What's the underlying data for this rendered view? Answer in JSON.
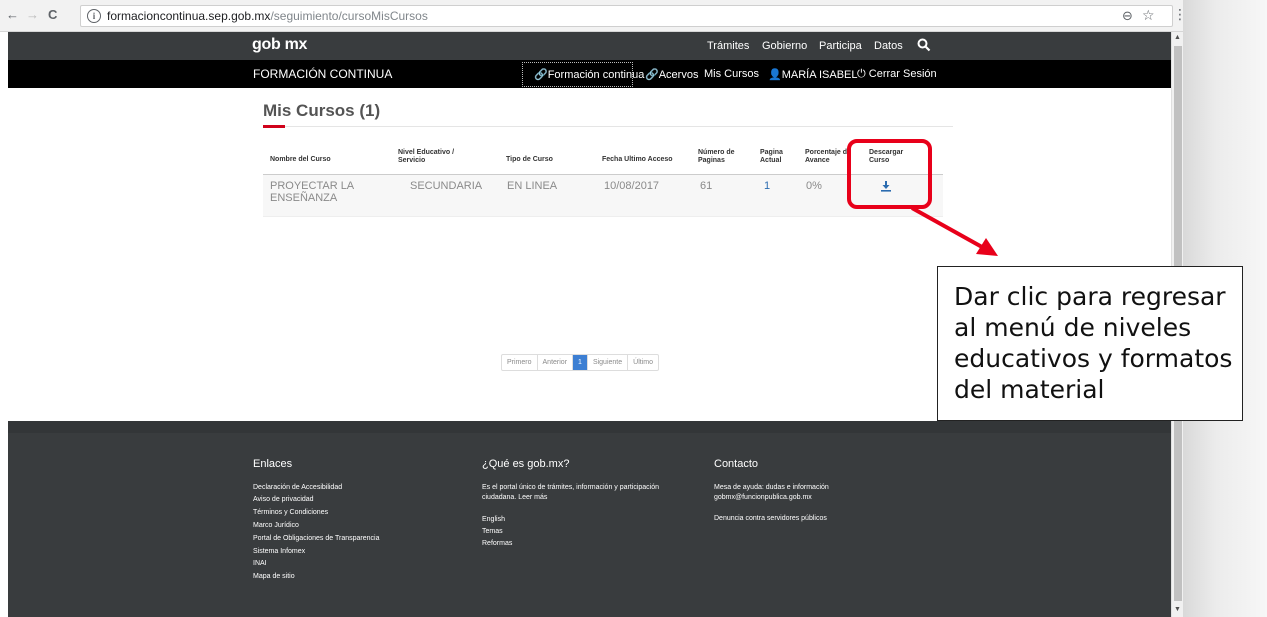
{
  "browser": {
    "back_icon": "←",
    "forward_icon": "→",
    "reload_icon": "C",
    "info_icon": "i",
    "url_host": "formacioncontinua.sep.gob.mx",
    "url_path": "/seguimiento/cursoMisCursos",
    "zoom_icon": "⊖",
    "star_icon": "☆",
    "menu_icon": "⋮"
  },
  "gob_bar": {
    "logo": "gob mx",
    "links": [
      "Trámites",
      "Gobierno",
      "Participa",
      "Datos"
    ]
  },
  "fc_bar": {
    "title": "FORMACIÓN CONTINUA",
    "links": [
      {
        "label": "Formación continua",
        "icon": "link-icon"
      },
      {
        "label": "Acervos",
        "icon": "link-icon"
      },
      {
        "label": "Mis Cursos",
        "icon": ""
      },
      {
        "label": "MARÍA ISABEL",
        "icon": "user-icon"
      },
      {
        "label": "Cerrar Sesión",
        "icon": "power-icon"
      }
    ],
    "glyphs": {
      "link": "🔗",
      "user": "👤",
      "power": "⏻"
    }
  },
  "main": {
    "title": "Mis Cursos (1)",
    "columns": [
      [
        "Nombre del Curso"
      ],
      [
        "Nivel Educativo /",
        "Servicio"
      ],
      [
        "Tipo de Curso"
      ],
      [
        "Fecha Ultimo Acceso"
      ],
      [
        "Número de",
        "Paginas"
      ],
      [
        "Pagina",
        "Actual"
      ],
      [
        "Porcentaje de",
        "Avance"
      ],
      [
        "Descargar",
        "Curso"
      ]
    ],
    "row": {
      "course_line1": "PROYECTAR LA",
      "course_line2": "ENSEÑANZA",
      "level": "SECUNDARIA",
      "type": "EN LINEA",
      "date": "10/08/2017",
      "pages": "61",
      "current_page": "1",
      "progress": "0%"
    }
  },
  "pager": {
    "first": "Primero",
    "prev": "Anterior",
    "current": "1",
    "next": "Siguiente",
    "last": "Último"
  },
  "footer": {
    "enlaces_title": "Enlaces",
    "enlaces": [
      "Declaración de Accesibilidad",
      "Aviso de privacidad",
      "Términos y Condiciones",
      "Marco Jurídico",
      "Portal de Obligaciones de Transparencia",
      "Sistema Infomex",
      "INAI",
      "Mapa de sitio"
    ],
    "que_title": "¿Qué es gob.mx?",
    "que_text1": "Es el portal único de trámites, información y participación",
    "que_text2": "ciudadana. Leer más",
    "que_links": [
      "English",
      "Temas",
      "Reformas"
    ],
    "contacto_title": "Contacto",
    "contacto_text1": "Mesa de ayuda: dudas e información",
    "contacto_text2": "gobmx@funcionpublica.gob.mx",
    "contacto_link": "Denuncia contra servidores públicos"
  },
  "callout": {
    "text": "Dar clic para regresar al menú de niveles educativos y formatos del material",
    "color": "#e8001a"
  }
}
